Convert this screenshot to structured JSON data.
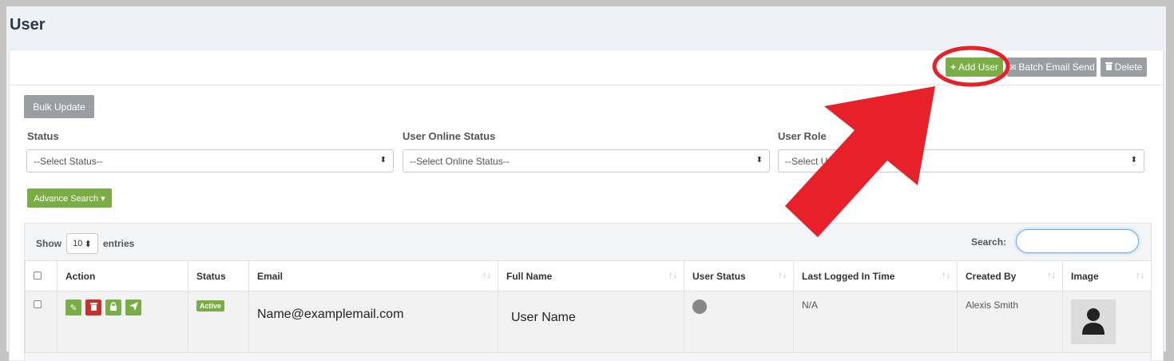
{
  "page": {
    "title": "User"
  },
  "toolbar": {
    "add_user_label": "Add User",
    "batch_email_label": "Batch Email Send",
    "delete_label": "Delete"
  },
  "bulk_update_label": "Bulk Update",
  "filters": {
    "status": {
      "label": "Status",
      "value": "--Select Status--"
    },
    "online_status": {
      "label": "User Online Status",
      "value": "--Select Online Status--"
    },
    "role": {
      "label": "User Role",
      "value": "--Select Us"
    }
  },
  "advance_search_label": "Advance Search ▾",
  "table": {
    "show_label": "Show",
    "entries_label": "entries",
    "page_length": "10",
    "search_label": "Search:",
    "columns": [
      "Action",
      "Status",
      "Email",
      "Full Name",
      "User Status",
      "Last Logged In Time",
      "Created By",
      "Image"
    ],
    "rows": [
      {
        "status": "Active",
        "email": "Name@examplemail.com",
        "full_name": "User Name",
        "last_logged_in": "N/A",
        "created_by": "Alexis Smith"
      }
    ]
  },
  "colors": {
    "accent_green": "#7aad45",
    "danger_red": "#c9302c",
    "annotation_red": "#e8202a"
  },
  "icons": [
    "plus-icon",
    "envelope-icon",
    "trash-icon",
    "edit-icon",
    "lock-icon",
    "paper-plane-icon",
    "user-avatar-icon",
    "sort-icon"
  ]
}
